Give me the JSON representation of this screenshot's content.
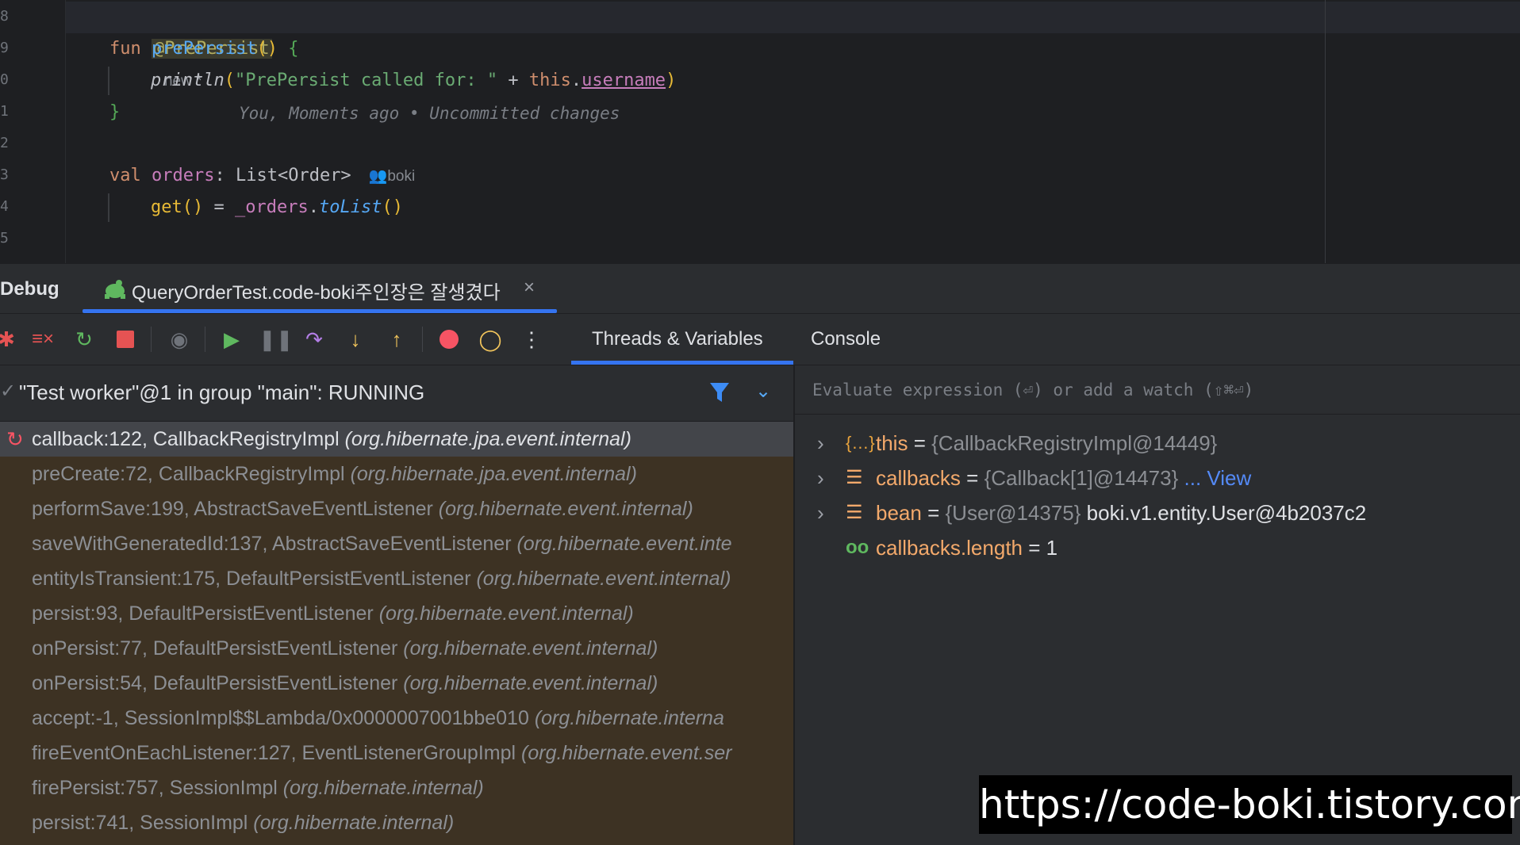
{
  "editor": {
    "line_numbers": [
      "8",
      "9",
      "0",
      "1",
      "2",
      "3",
      "4",
      "5"
    ],
    "line1": {
      "annotation": "@PrePersist",
      "badge": "new *",
      "blame": "You, Moments ago • Uncommitted changes"
    },
    "line2": {
      "kw": "fun",
      "name": "prePersist",
      "parens": "()",
      "brace": "{"
    },
    "line3": {
      "call": "println",
      "open": "(",
      "string": "\"PrePersist called for: \"",
      "plus": " + ",
      "this": "this",
      "dot": ".",
      "field": "username",
      "close": ")"
    },
    "line4": {
      "brace": "}"
    },
    "line6": {
      "kw": "val",
      "name": "orders",
      "colon": ": ",
      "type": "List<Order>",
      "author": "boki"
    },
    "line7": {
      "getter": "get",
      "parens": "()",
      "eq": " = ",
      "field": "_orders",
      "dot": ".",
      "call": "toList",
      "call_parens": "()"
    }
  },
  "debug": {
    "title": "Debug",
    "session": "QueryOrderTest.code-boki주인장은 잘생겼다",
    "close": "×"
  },
  "toolbar": {
    "icons": {
      "rerun": "bug-icon",
      "clear": "clear-all-icon",
      "restart": "restart-icon",
      "stop": "stop-icon",
      "view": "eye-icon",
      "resume": "resume-icon",
      "pause": "pause-icon",
      "step_over": "step-over-icon",
      "step_into": "step-into-icon",
      "step_out": "step-out-icon",
      "breakpoints": "view-breakpoints-icon",
      "mute": "mute-breakpoints-icon",
      "more": "more-icon"
    },
    "tabs": [
      "Threads & Variables",
      "Console"
    ]
  },
  "threads": {
    "check": "✓",
    "label": "\"Test worker\"@1 in group \"main\": RUNNING",
    "dropdown": "⌄"
  },
  "frames": [
    {
      "method": "callback:122, CallbackRegistryImpl ",
      "pkg": "(org.hibernate.jpa.event.internal)"
    },
    {
      "method": "preCreate:72, CallbackRegistryImpl ",
      "pkg": "(org.hibernate.jpa.event.internal)"
    },
    {
      "method": "performSave:199, AbstractSaveEventListener ",
      "pkg": "(org.hibernate.event.internal)"
    },
    {
      "method": "saveWithGeneratedId:137, AbstractSaveEventListener ",
      "pkg": "(org.hibernate.event.inte"
    },
    {
      "method": "entityIsTransient:175, DefaultPersistEventListener ",
      "pkg": "(org.hibernate.event.internal)"
    },
    {
      "method": "persist:93, DefaultPersistEventListener ",
      "pkg": "(org.hibernate.event.internal)"
    },
    {
      "method": "onPersist:77, DefaultPersistEventListener ",
      "pkg": "(org.hibernate.event.internal)"
    },
    {
      "method": "onPersist:54, DefaultPersistEventListener ",
      "pkg": "(org.hibernate.event.internal)"
    },
    {
      "method": "accept:-1, SessionImpl$$Lambda/0x0000007001bbe010 ",
      "pkg": "(org.hibernate.interna"
    },
    {
      "method": "fireEventOnEachListener:127, EventListenerGroupImpl ",
      "pkg": "(org.hibernate.event.ser"
    },
    {
      "method": "firePersist:757, SessionImpl ",
      "pkg": "(org.hibernate.internal)"
    },
    {
      "method": "persist:741, SessionImpl ",
      "pkg": "(org.hibernate.internal)"
    }
  ],
  "variables": {
    "placeholder": "Evaluate expression (⏎) or add a watch (⇧⌘⏎)",
    "items": [
      {
        "icon": "{…}",
        "name": "this",
        "eq": " = ",
        "ref": "{CallbackRegistryImpl@14449}",
        "val": "",
        "link": ""
      },
      {
        "icon": "☰",
        "name": "callbacks",
        "eq": " = ",
        "ref": "{Callback[1]@14473}",
        "val": "",
        "link": "... View"
      },
      {
        "icon": "☰",
        "name": "bean",
        "eq": " = ",
        "ref": "{User@14375}",
        "val": " boki.v1.entity.User@4b2037c2",
        "link": ""
      },
      {
        "icon": "oo",
        "name": "callbacks.length",
        "eq": " = ",
        "ref": "",
        "val": "1",
        "link": ""
      }
    ]
  },
  "watermark": "https://code-boki.tistory.com",
  "colors": {
    "accent": "#3574f0",
    "frames_bg": "#3d3223",
    "stop": "#e55353",
    "resume": "#5fb85f",
    "step": "#f2c55c"
  }
}
